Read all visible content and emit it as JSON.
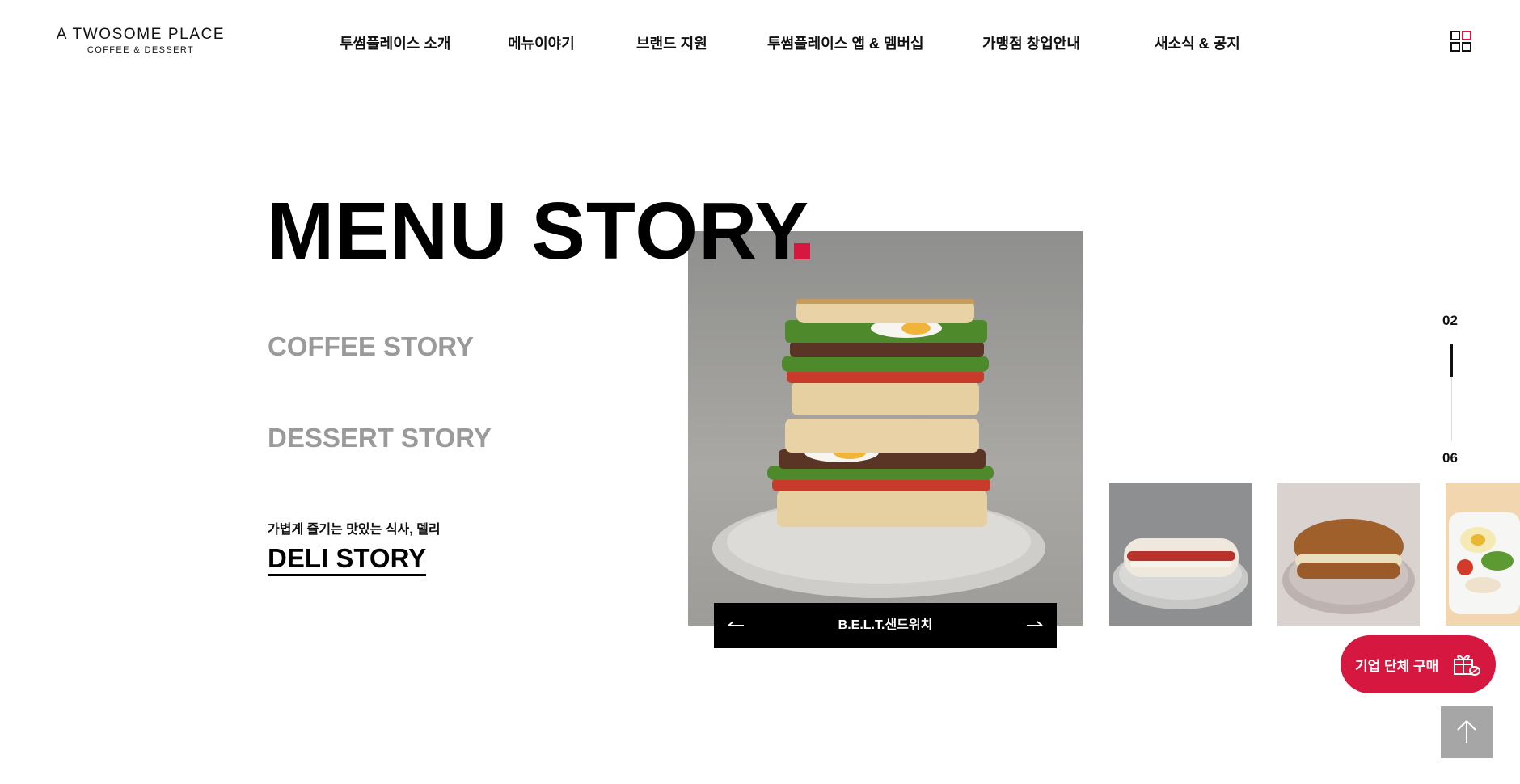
{
  "brand": {
    "logo_main": "A TWOSOME PLACE",
    "logo_sub": "COFFEE & DESSERT"
  },
  "nav": {
    "items": [
      {
        "label": "투썸플레이스 소개"
      },
      {
        "label": "메뉴이야기"
      },
      {
        "label": "브랜드 지원"
      },
      {
        "label": "투썸플레이스 앱 & 멤버십"
      },
      {
        "label": "가맹점 창업안내"
      },
      {
        "label": "새소식 & 공지"
      }
    ],
    "grid_icon": "grid-menu-icon"
  },
  "section": {
    "title": "MENU STORY",
    "accent_color": "#d6173f",
    "categories": [
      {
        "label": "COFFEE STORY"
      },
      {
        "label": "DESSERT STORY"
      }
    ],
    "active": {
      "desc": "가볍게 즐기는 맛있는 식사, 델리",
      "label": "DELI STORY"
    }
  },
  "slider": {
    "current_item": "B.E.L.T.샌드위치",
    "prev_icon": "arrow-left-icon",
    "next_icon": "arrow-right-icon",
    "page_current": "02",
    "page_total": "06",
    "progress": 0.33
  },
  "floating": {
    "corp_label": "기업 단체 구매",
    "corp_icon": "gift-coffee-icon",
    "top_icon": "arrow-up-icon"
  }
}
